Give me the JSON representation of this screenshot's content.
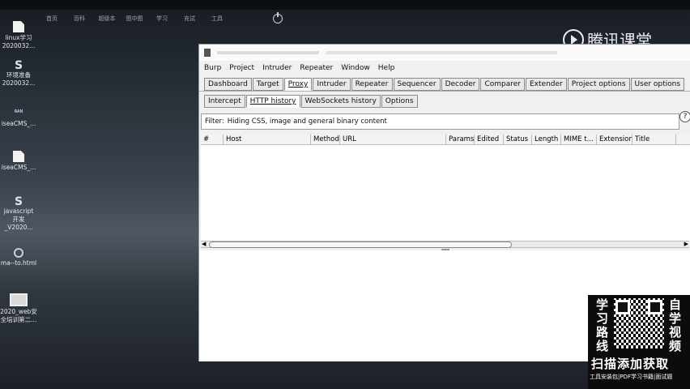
{
  "taskbar": [
    "首页",
    "百科",
    "超级本",
    "图中图",
    "学习",
    "充试",
    "工具"
  ],
  "desktop_icons": [
    {
      "label": "linux学习 2020032...",
      "icon": "doc-icon"
    },
    {
      "label": "环境准备 2020032...",
      "icon": "s-icon"
    },
    {
      "label": "iseaCMS_...",
      "icon": "ran-icon"
    },
    {
      "label": "iseaCMS_...",
      "icon": "doc-icon"
    },
    {
      "label": "javascript 开发_V2020...",
      "icon": "s-icon"
    },
    {
      "label": "ma--to.html",
      "icon": "key-icon"
    },
    {
      "label": "2020_web安 全培训第二...",
      "icon": "image-icon"
    }
  ],
  "watermark": "腾讯课堂",
  "burp": {
    "menu": [
      "Burp",
      "Project",
      "Intruder",
      "Repeater",
      "Window",
      "Help"
    ],
    "tabs": [
      "Dashboard",
      "Target",
      "Proxy",
      "Intruder",
      "Repeater",
      "Sequencer",
      "Decoder",
      "Comparer",
      "Extender",
      "Project options",
      "User options"
    ],
    "active_tab": "Proxy",
    "subtabs": [
      "Intercept",
      "HTTP history",
      "WebSockets history",
      "Options"
    ],
    "active_subtab": "HTTP history",
    "filter_label": "Filter:",
    "filter_text": "Hiding CSS, image and general binary content",
    "help": "?",
    "columns": [
      "#",
      "Host",
      "Method",
      "URL",
      "Params",
      "Edited",
      "Status",
      "Length",
      "MIME t...",
      "Extension",
      "Title"
    ]
  },
  "promo": {
    "left": [
      "学",
      "习",
      "路",
      "线"
    ],
    "right": [
      "自",
      "学",
      "视",
      "频"
    ],
    "cta": "扫描添加获取",
    "footer": "工具安装包|PDF学习书籍|面试题"
  }
}
